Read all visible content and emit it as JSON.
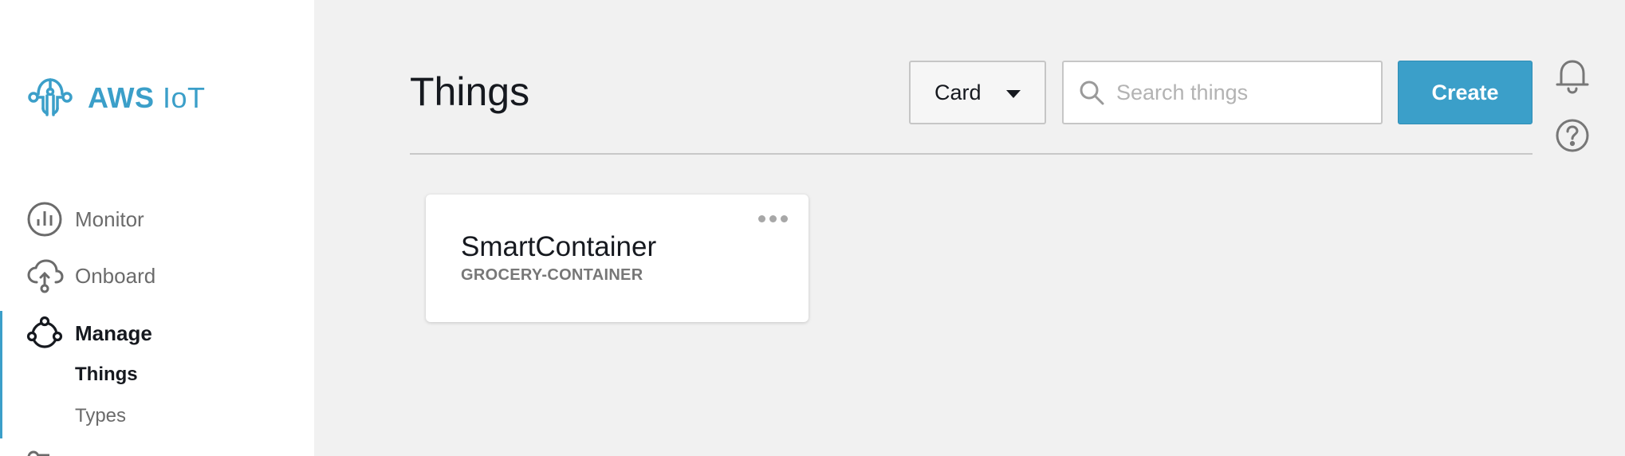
{
  "brand": {
    "name_bold": "AWS",
    "name_light": "IoT"
  },
  "nav": {
    "items": [
      {
        "label": "Monitor",
        "icon": "bar-chart-icon"
      },
      {
        "label": "Onboard",
        "icon": "cloud-upload-icon"
      },
      {
        "label": "Manage",
        "icon": "manage-nodes-icon",
        "active": true
      }
    ],
    "sub_items": [
      {
        "label": "Things",
        "active": true
      },
      {
        "label": "Types",
        "active": false
      }
    ]
  },
  "header": {
    "title": "Things",
    "view_select": {
      "value": "Card"
    },
    "search": {
      "placeholder": "Search things",
      "value": ""
    },
    "create_label": "Create"
  },
  "things": [
    {
      "name": "SmartContainer",
      "type": "GROCERY-CONTAINER"
    }
  ],
  "colors": {
    "accent": "#3b9fc9",
    "background": "#f1f1f1",
    "sidebar": "#ffffff",
    "text": "#16191f",
    "muted": "#6b6b6b"
  }
}
